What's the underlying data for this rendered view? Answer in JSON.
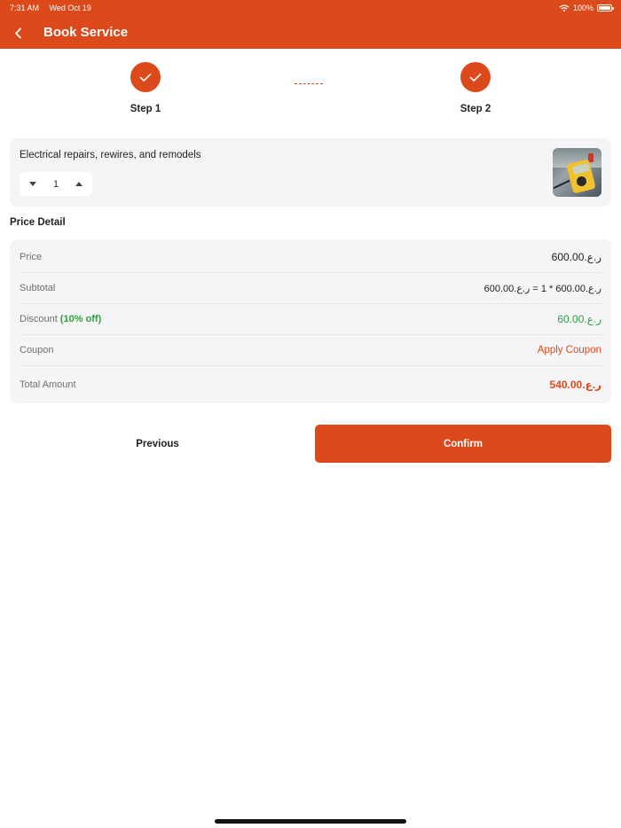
{
  "status_bar": {
    "time": "7:31 AM",
    "date": "Wed Oct 19",
    "battery": "100%"
  },
  "header": {
    "title": "Book Service",
    "back_icon": "chevron-left-icon"
  },
  "stepper": {
    "steps": [
      {
        "label": "Step 1",
        "status": "completed"
      },
      {
        "label": "Step 2",
        "status": "completed"
      }
    ]
  },
  "service": {
    "name": "Electrical repairs, rewires, and remodels",
    "quantity": "1",
    "image_icon": "electrical-multimeter-photo"
  },
  "price_detail": {
    "title": "Price Detail",
    "price_label": "Price",
    "price_value": "ر.ع.600.00",
    "subtotal_label": "Subtotal",
    "subtotal_value": "ر.ع.600.00 * 1  =  ر.ع.600.00",
    "discount_label": "Discount",
    "discount_percent": "(10% off)",
    "discount_value": "ر.ع.60.00",
    "coupon_label": "Coupon",
    "coupon_action": "Apply Coupon",
    "total_label": "Total Amount",
    "total_value": "ر.ع.540.00"
  },
  "actions": {
    "previous": "Previous",
    "confirm": "Confirm"
  },
  "colors": {
    "brand": "#DC4A1B",
    "success": "#2E9E3F",
    "card_bg": "#F5F5F7"
  }
}
